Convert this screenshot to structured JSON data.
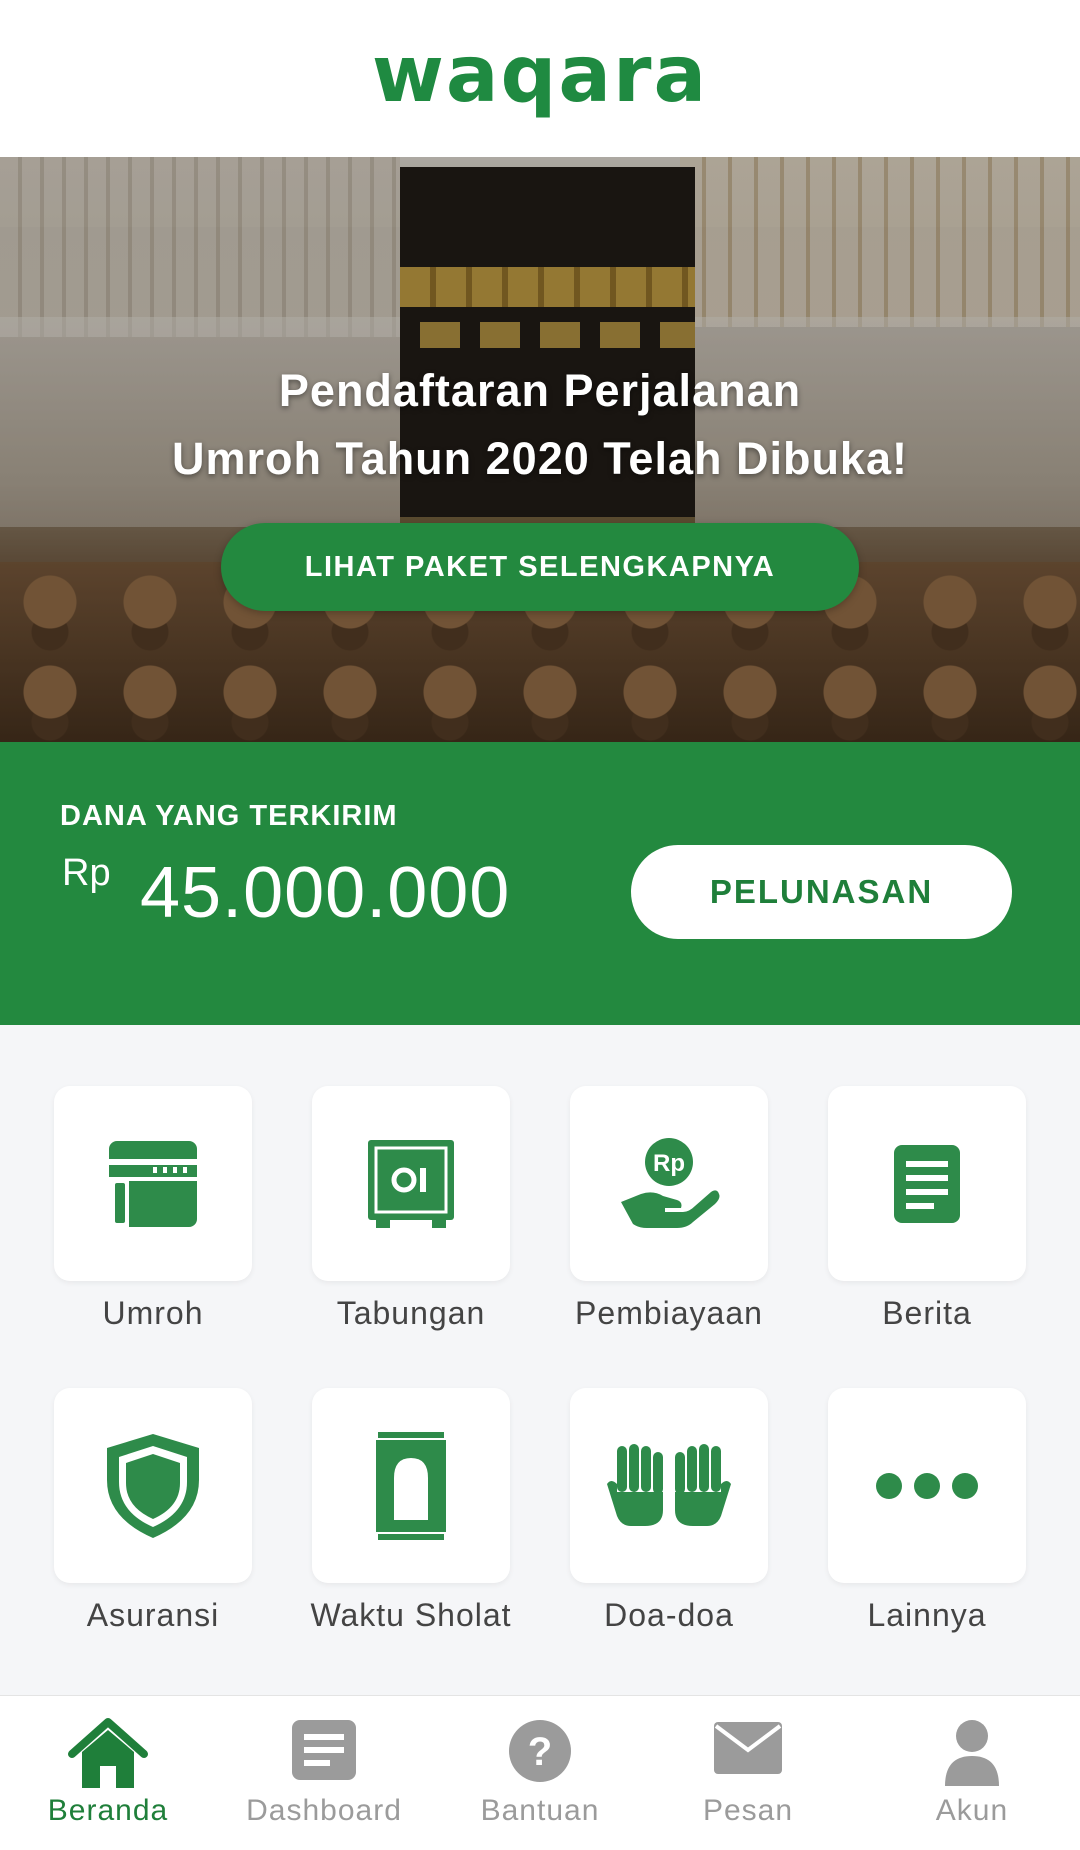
{
  "header": {
    "logo": "waqara"
  },
  "hero": {
    "title_line1": "Pendaftaran Perjalanan",
    "title_line2": "Umroh Tahun 2020 Telah Dibuka!",
    "cta_label": "LIHAT PAKET SELENGKAPNYA"
  },
  "funds": {
    "label": "DANA YANG TERKIRIM",
    "currency": "Rp",
    "amount": "45.000.000",
    "button_label": "PELUNASAN"
  },
  "menu": {
    "items": [
      {
        "label": "Umroh",
        "icon": "kaaba-icon"
      },
      {
        "label": "Tabungan",
        "icon": "safe-icon"
      },
      {
        "label": "Pembiayaan",
        "icon": "hand-money-icon"
      },
      {
        "label": "Berita",
        "icon": "document-icon"
      },
      {
        "label": "Asuransi",
        "icon": "shield-icon"
      },
      {
        "label": "Waktu Sholat",
        "icon": "prayer-mat-icon"
      },
      {
        "label": "Doa-doa",
        "icon": "praying-hands-icon"
      },
      {
        "label": "Lainnya",
        "icon": "more-dots-icon"
      }
    ]
  },
  "nav": {
    "items": [
      {
        "label": "Beranda",
        "icon": "home-icon",
        "active": true
      },
      {
        "label": "Dashboard",
        "icon": "dashboard-icon",
        "active": false
      },
      {
        "label": "Bantuan",
        "icon": "help-icon",
        "active": false
      },
      {
        "label": "Pesan",
        "icon": "mail-icon",
        "active": false
      },
      {
        "label": "Akun",
        "icon": "user-icon",
        "active": false
      }
    ]
  },
  "colors": {
    "brand_green": "#23893f",
    "icon_green": "#2e8b4a",
    "nav_inactive": "#9b9b9b",
    "background": "#f5f6f8"
  }
}
